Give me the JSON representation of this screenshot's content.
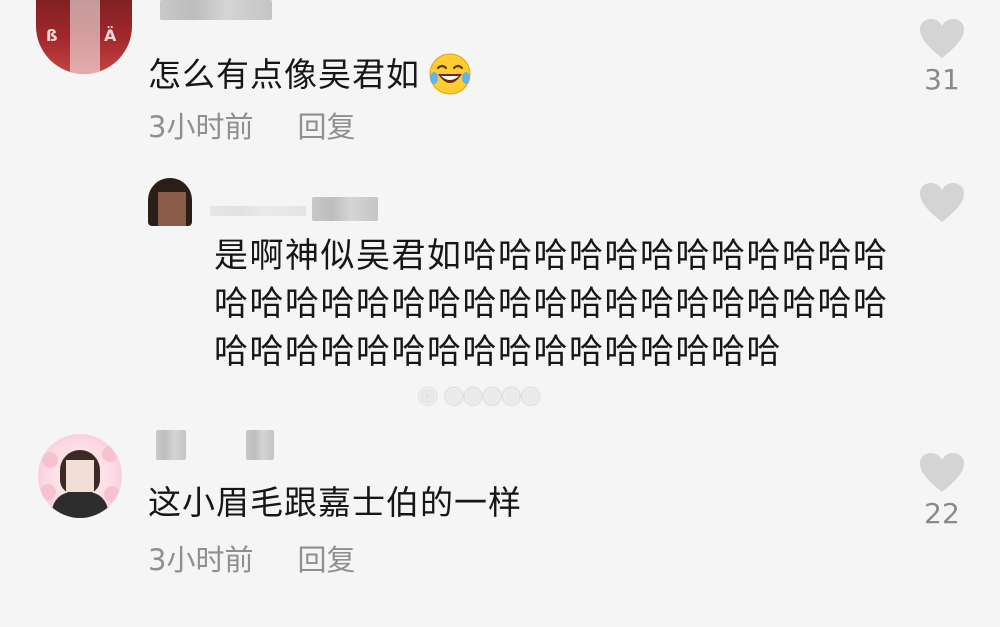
{
  "comments": [
    {
      "text": "怎么有点像吴君如",
      "emoji": "rolling-on-floor-laughing",
      "time": "3小时前",
      "reply_label": "回复",
      "likes": "31"
    },
    {
      "text": "是啊神似吴君如哈哈哈哈哈哈哈哈哈哈哈哈哈哈哈哈哈哈哈哈哈哈哈哈哈哈哈哈哈哈哈哈哈哈哈哈哈哈哈哈哈哈哈哈哈哈哈"
    },
    {
      "text": "这小眉毛跟嘉士伯的一样",
      "time": "3小时前",
      "reply_label": "回复",
      "likes": "22"
    }
  ],
  "colors": {
    "background": "#f5f5f5",
    "text": "#161616",
    "meta": "#8f8f8f",
    "heart": "#d4d4d4"
  },
  "icons": {
    "like": "heart-icon"
  }
}
